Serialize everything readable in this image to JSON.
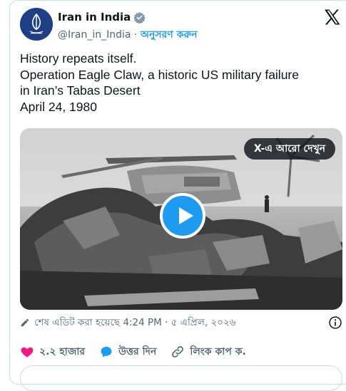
{
  "header": {
    "account_name": "Iran in India",
    "handle": "@Iran_in_India",
    "separator": "·",
    "follow_label": "অনুসরণ করুন"
  },
  "tweet": {
    "lines": [
      "History repeats itself.",
      "Operation Eagle Claw, a historic US military failure",
      "in Iran’s Tabas Desert",
      "April 24, 1980"
    ]
  },
  "media": {
    "see_more_label": "X-এ আরো দেখুন"
  },
  "meta": {
    "edited_text": "শেষ এডিট করা হয়েছে 4:24 PM · ৫ এপ্রিল, ২০২৬"
  },
  "actions": {
    "like_count": "২.২ হাজার",
    "reply_label": "উত্তর দিন",
    "copy_link_label": "লিংক কাপ ক."
  },
  "colors": {
    "accent": "#1d9bf0",
    "like": "#f91880",
    "muted": "#536471"
  }
}
